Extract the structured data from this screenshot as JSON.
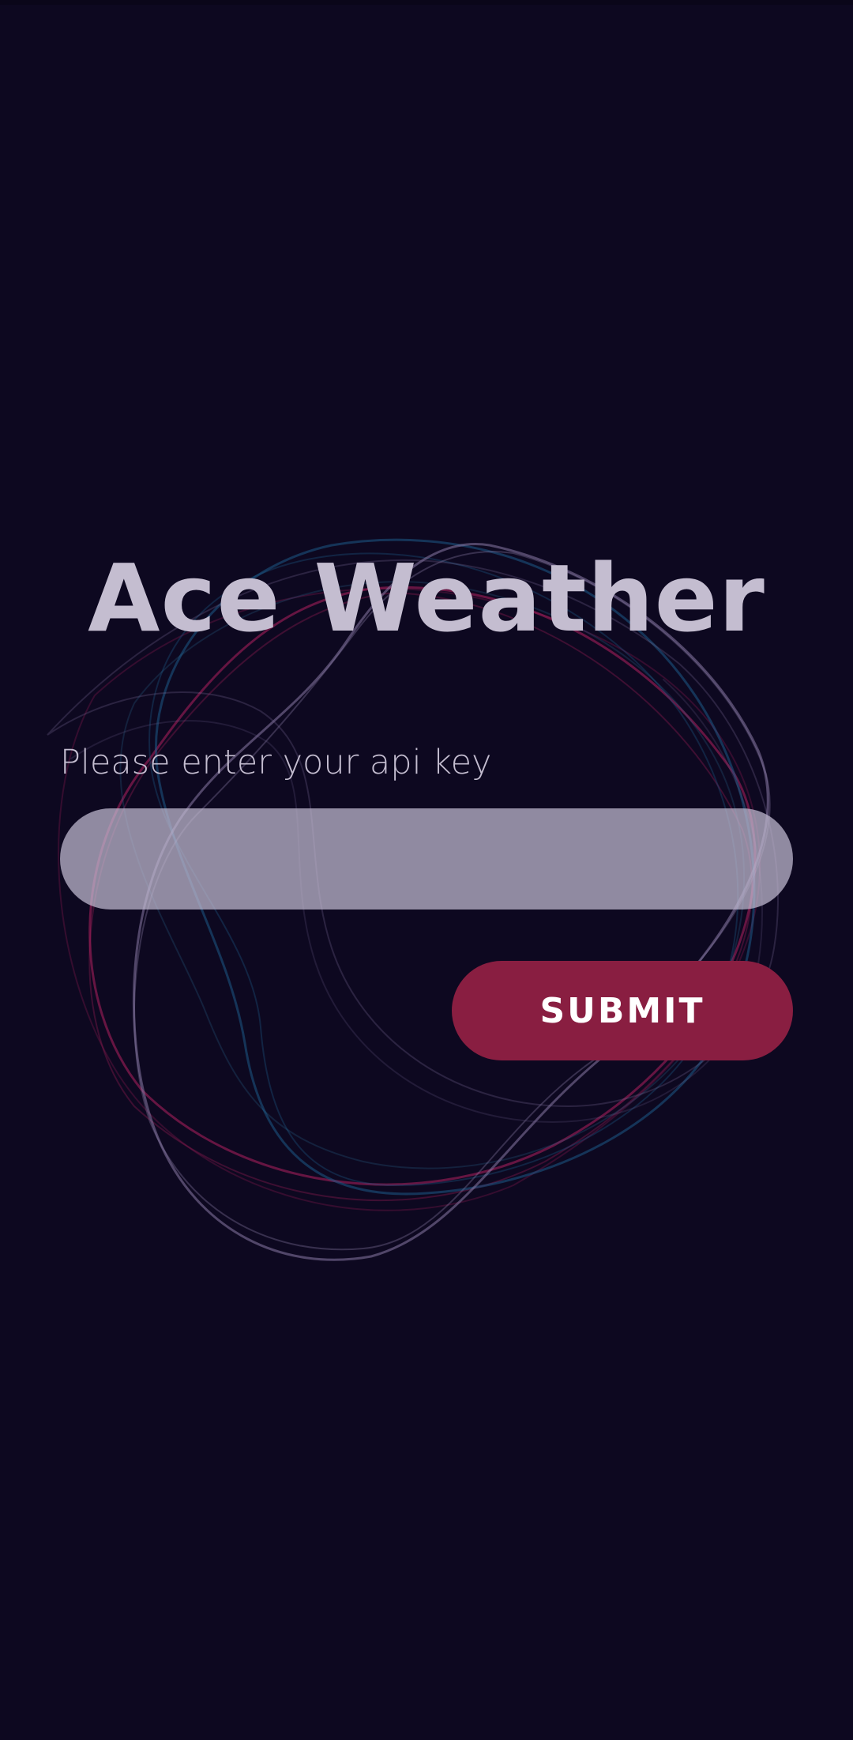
{
  "app": {
    "title": "Ace Weather"
  },
  "form": {
    "label": "Please enter your api key",
    "api_key_value": "",
    "api_key_placeholder": "",
    "submit_label": "SUBMIT"
  },
  "colors": {
    "background": "#0d0820",
    "title_text": "#c4bdd0",
    "input_fill": "#9a93a8",
    "submit_button": "#891e41",
    "ring_pink": "#b0205e",
    "ring_blue": "#1e5a86",
    "ring_lavender": "#8a7aa6"
  },
  "decor": {
    "background_graphic": "swirling-rings"
  }
}
